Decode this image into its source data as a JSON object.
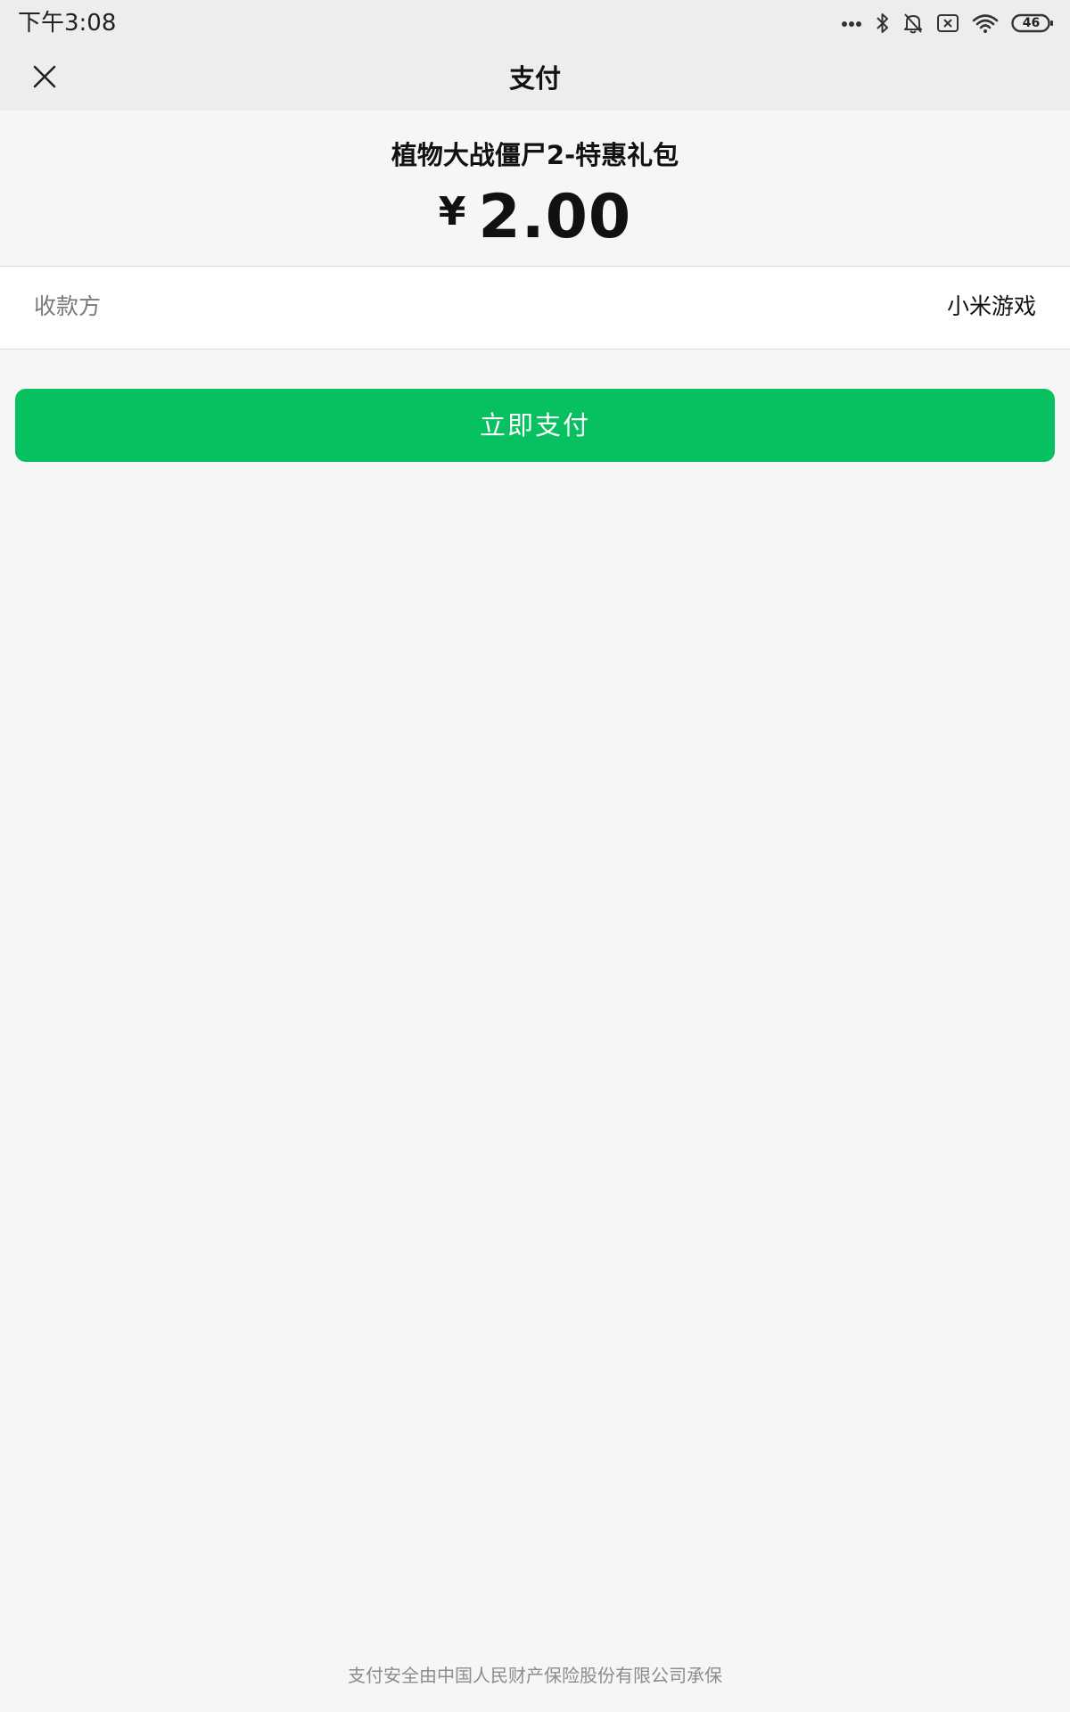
{
  "status_bar": {
    "time": "下午3:08",
    "battery_level": "46",
    "icons": [
      "more-dots-icon",
      "bluetooth-icon",
      "mute-bell-icon",
      "sim-off-icon",
      "wifi-icon",
      "battery-icon"
    ]
  },
  "header": {
    "title": "支付",
    "close_icon": "close-icon"
  },
  "order": {
    "product_name": "植物大战僵尸2-特惠礼包",
    "currency_symbol": "¥",
    "amount": "2.00"
  },
  "payee": {
    "label": "收款方",
    "value": "小米游戏"
  },
  "actions": {
    "pay_label": "立即支付"
  },
  "footer": {
    "note": "支付安全由中国人民财产保险股份有限公司承保"
  },
  "colors": {
    "accent": "#07c160",
    "header_bg": "#ededed",
    "page_bg": "#f6f6f6"
  }
}
